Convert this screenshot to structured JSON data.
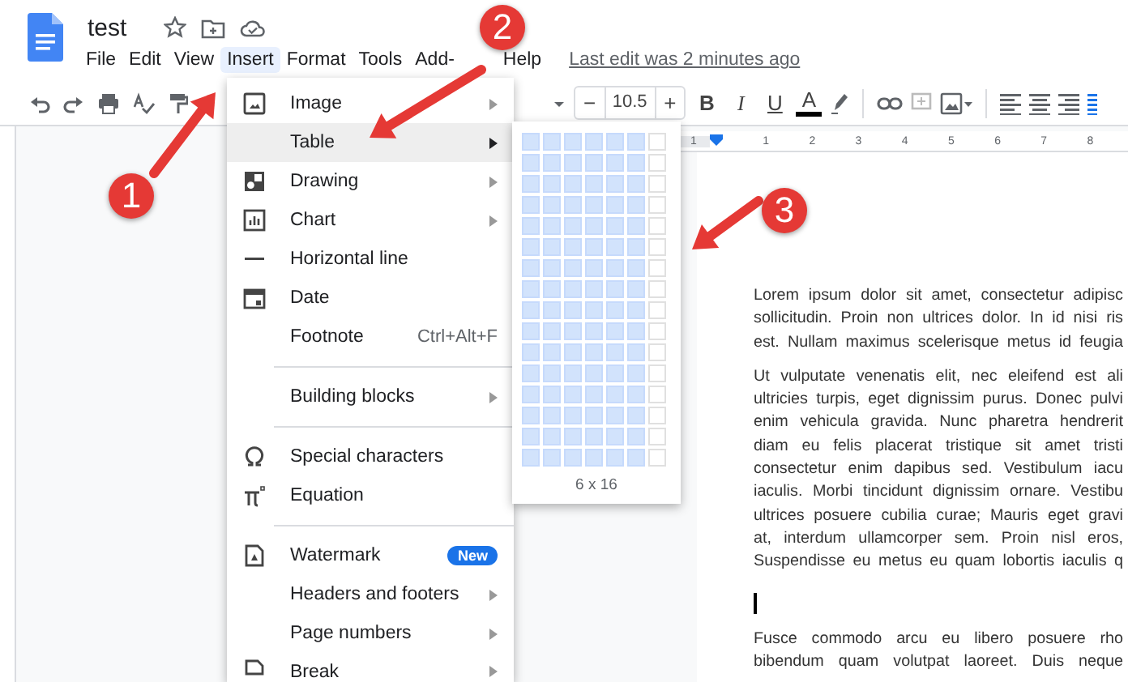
{
  "document": {
    "title": "test"
  },
  "menu_bar": [
    {
      "label": "File",
      "selected": false
    },
    {
      "label": "Edit",
      "selected": false
    },
    {
      "label": "View",
      "selected": false
    },
    {
      "label": "Insert",
      "selected": true
    },
    {
      "label": "Format",
      "selected": false
    },
    {
      "label": "Tools",
      "selected": false
    },
    {
      "label": "Add-",
      "selected": false
    },
    {
      "label": "Help",
      "selected": false
    }
  ],
  "last_edit": "Last edit was 2 minutes ago",
  "toolbar": {
    "font_size": "10.5",
    "minus": "−",
    "plus": "+",
    "bold": "B",
    "italic": "I",
    "underline": "U",
    "text_color": "A"
  },
  "ruler": [
    "1",
    "1",
    "2",
    "3",
    "4",
    "5",
    "6",
    "7",
    "8"
  ],
  "insert_menu": [
    {
      "kind": "item",
      "label": "Image",
      "has_submenu": true,
      "selected": false
    },
    {
      "kind": "item",
      "label": "Table",
      "has_submenu": true,
      "selected": true
    },
    {
      "kind": "item",
      "label": "Drawing",
      "has_submenu": true,
      "selected": false
    },
    {
      "kind": "item",
      "label": "Chart",
      "has_submenu": true,
      "selected": false
    },
    {
      "kind": "item",
      "label": "Horizontal line",
      "has_submenu": false,
      "selected": false
    },
    {
      "kind": "item",
      "label": "Date",
      "has_submenu": false,
      "selected": false
    },
    {
      "kind": "item",
      "label": "Footnote",
      "shortcut": "Ctrl+Alt+F",
      "has_submenu": false,
      "selected": false
    },
    {
      "kind": "divider"
    },
    {
      "kind": "item",
      "label": "Building blocks",
      "has_submenu": true,
      "selected": false
    },
    {
      "kind": "divider"
    },
    {
      "kind": "item",
      "label": "Special characters",
      "has_submenu": false,
      "selected": false
    },
    {
      "kind": "item",
      "label": "Equation",
      "has_submenu": false,
      "selected": false
    },
    {
      "kind": "divider"
    },
    {
      "kind": "item",
      "label": "Watermark",
      "badge": "New",
      "has_submenu": false,
      "selected": false
    },
    {
      "kind": "item",
      "label": "Headers and footers",
      "has_submenu": true,
      "selected": false
    },
    {
      "kind": "item",
      "label": "Page numbers",
      "has_submenu": true,
      "selected": false
    },
    {
      "kind": "item",
      "label": "Break",
      "has_submenu": true,
      "selected": false
    }
  ],
  "table_picker": {
    "size_label": "6 x 16",
    "rows": [
      {
        "cells": [
          {
            "selected": true
          },
          {
            "selected": true
          },
          {
            "selected": true
          },
          {
            "selected": true
          },
          {
            "selected": true
          },
          {
            "selected": true
          },
          {
            "selected": false
          }
        ]
      },
      {
        "cells": [
          {
            "selected": true
          },
          {
            "selected": true
          },
          {
            "selected": true
          },
          {
            "selected": true
          },
          {
            "selected": true
          },
          {
            "selected": true
          },
          {
            "selected": false
          }
        ]
      },
      {
        "cells": [
          {
            "selected": true
          },
          {
            "selected": true
          },
          {
            "selected": true
          },
          {
            "selected": true
          },
          {
            "selected": true
          },
          {
            "selected": true
          },
          {
            "selected": false
          }
        ]
      },
      {
        "cells": [
          {
            "selected": true
          },
          {
            "selected": true
          },
          {
            "selected": true
          },
          {
            "selected": true
          },
          {
            "selected": true
          },
          {
            "selected": true
          },
          {
            "selected": false
          }
        ]
      },
      {
        "cells": [
          {
            "selected": true
          },
          {
            "selected": true
          },
          {
            "selected": true
          },
          {
            "selected": true
          },
          {
            "selected": true
          },
          {
            "selected": true
          },
          {
            "selected": false
          }
        ]
      },
      {
        "cells": [
          {
            "selected": true
          },
          {
            "selected": true
          },
          {
            "selected": true
          },
          {
            "selected": true
          },
          {
            "selected": true
          },
          {
            "selected": true
          },
          {
            "selected": false
          }
        ]
      },
      {
        "cells": [
          {
            "selected": true
          },
          {
            "selected": true
          },
          {
            "selected": true
          },
          {
            "selected": true
          },
          {
            "selected": true
          },
          {
            "selected": true
          },
          {
            "selected": false
          }
        ]
      },
      {
        "cells": [
          {
            "selected": true
          },
          {
            "selected": true
          },
          {
            "selected": true
          },
          {
            "selected": true
          },
          {
            "selected": true
          },
          {
            "selected": true
          },
          {
            "selected": false
          }
        ]
      },
      {
        "cells": [
          {
            "selected": true
          },
          {
            "selected": true
          },
          {
            "selected": true
          },
          {
            "selected": true
          },
          {
            "selected": true
          },
          {
            "selected": true
          },
          {
            "selected": false
          }
        ]
      },
      {
        "cells": [
          {
            "selected": true
          },
          {
            "selected": true
          },
          {
            "selected": true
          },
          {
            "selected": true
          },
          {
            "selected": true
          },
          {
            "selected": true
          },
          {
            "selected": false
          }
        ]
      },
      {
        "cells": [
          {
            "selected": true
          },
          {
            "selected": true
          },
          {
            "selected": true
          },
          {
            "selected": true
          },
          {
            "selected": true
          },
          {
            "selected": true
          },
          {
            "selected": false
          }
        ]
      },
      {
        "cells": [
          {
            "selected": true
          },
          {
            "selected": true
          },
          {
            "selected": true
          },
          {
            "selected": true
          },
          {
            "selected": true
          },
          {
            "selected": true
          },
          {
            "selected": false
          }
        ]
      },
      {
        "cells": [
          {
            "selected": true
          },
          {
            "selected": true
          },
          {
            "selected": true
          },
          {
            "selected": true
          },
          {
            "selected": true
          },
          {
            "selected": true
          },
          {
            "selected": false
          }
        ]
      },
      {
        "cells": [
          {
            "selected": true
          },
          {
            "selected": true
          },
          {
            "selected": true
          },
          {
            "selected": true
          },
          {
            "selected": true
          },
          {
            "selected": true
          },
          {
            "selected": false
          }
        ]
      },
      {
        "cells": [
          {
            "selected": true
          },
          {
            "selected": true
          },
          {
            "selected": true
          },
          {
            "selected": true
          },
          {
            "selected": true
          },
          {
            "selected": true
          },
          {
            "selected": false
          }
        ]
      },
      {
        "cells": [
          {
            "selected": true
          },
          {
            "selected": true
          },
          {
            "selected": true
          },
          {
            "selected": true
          },
          {
            "selected": true
          },
          {
            "selected": true
          },
          {
            "selected": false
          }
        ]
      }
    ]
  },
  "paragraphs": [
    {
      "lines": [
        "Lorem ipsum dolor sit amet, consectetur adipisc",
        "sollicitudin. Proin non ultrices dolor. In id nisi ris",
        "est. Nullam maximus scelerisque metus id feugia"
      ]
    },
    {
      "lines": [
        "Ut vulputate venenatis elit, nec eleifend est ali",
        "ultricies turpis, eget dignissim purus. Donec pulvi",
        "enim vehicula gravida. Nunc pharetra hendrerit",
        "diam eu felis placerat tristique sit amet tristi",
        "consectetur enim dapibus sed. Vestibulum iacu",
        "iaculis. Morbi tincidunt dignissim ornare. Vestibu",
        "ultrices posuere cubilia curae; Mauris eget gravi",
        "at, interdum ullamcorper sem. Proin nisl eros,",
        "Suspendisse eu metus eu quam lobortis iaculis q"
      ]
    },
    {
      "kind": "cursor"
    },
    {
      "lines": [
        "Fusce commodo arcu eu libero posuere rho",
        "bibendum quam volutpat laoreet. Duis neque"
      ]
    }
  ],
  "annotations": [
    {
      "label": "1"
    },
    {
      "label": "2"
    },
    {
      "label": "3"
    }
  ]
}
